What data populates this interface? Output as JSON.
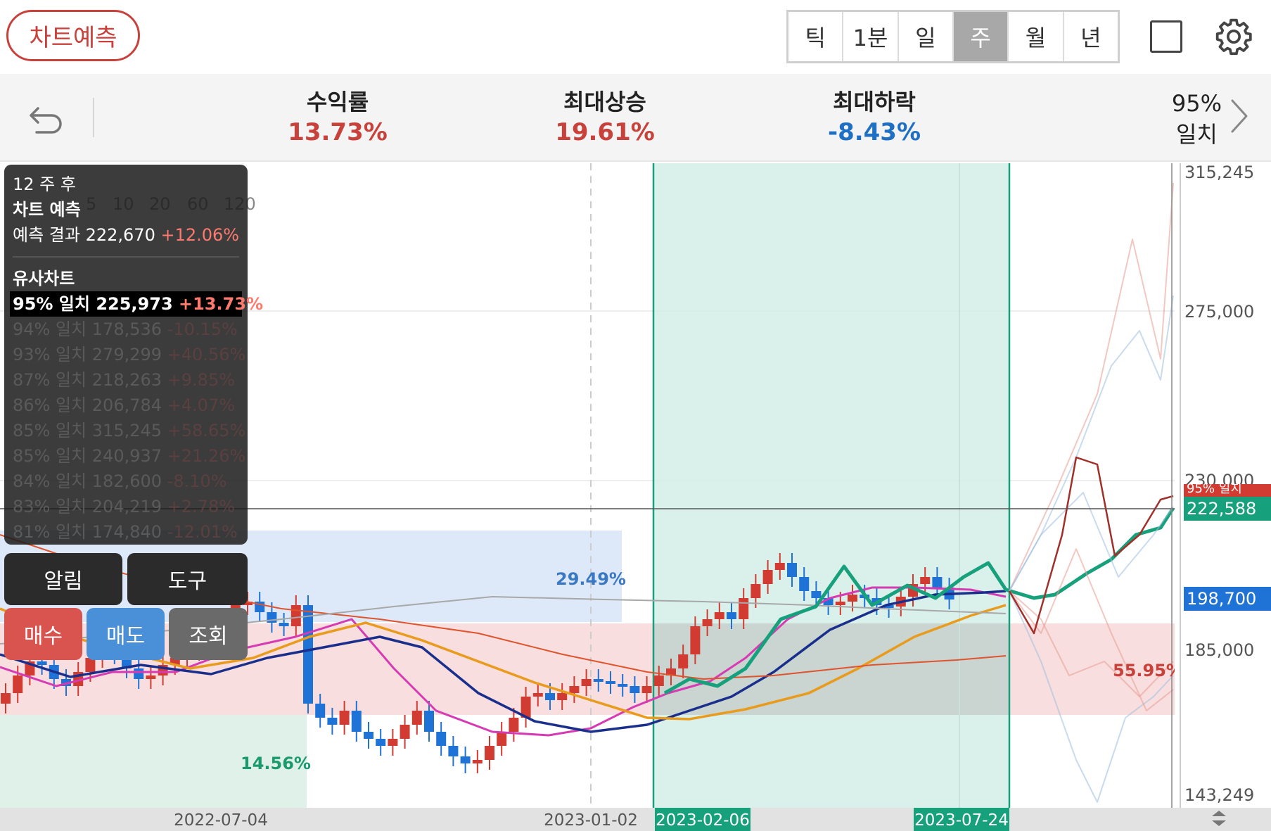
{
  "header": {
    "forecast_button": "차트예측",
    "periods": [
      "틱",
      "1분",
      "일",
      "주",
      "월",
      "년"
    ],
    "active_period": "주"
  },
  "stats": {
    "return_label": "수익률",
    "return_value": "13.73%",
    "max_rise_label": "최대상승",
    "max_rise_value": "19.61%",
    "max_drop_label": "최대하락",
    "max_drop_value": "-8.43%",
    "match_pct": "95%",
    "match_word": "일치"
  },
  "info_panel": {
    "weeks_after": "12 주 후",
    "forecast_title": "차트 예측",
    "forecast_result_label": "예측 결과",
    "forecast_result_price": "222,670",
    "forecast_result_change": "+12.06%",
    "similar_title": "유사차트",
    "matches": [
      {
        "label": "95% 일치",
        "price": "225,973",
        "change": "+13.73%",
        "dir": "pos"
      },
      {
        "label": "94% 일치",
        "price": "178,536",
        "change": "-10.15%",
        "dir": "neg"
      },
      {
        "label": "93% 일치",
        "price": "279,299",
        "change": "+40.56%",
        "dir": "pos"
      },
      {
        "label": "87% 일치",
        "price": "218,263",
        "change": "+9.85%",
        "dir": "pos"
      },
      {
        "label": "86% 일치",
        "price": "206,784",
        "change": "+4.07%",
        "dir": "pos"
      },
      {
        "label": "85% 일치",
        "price": "315,245",
        "change": "+58.65%",
        "dir": "pos"
      },
      {
        "label": "85% 일치",
        "price": "240,937",
        "change": "+21.26%",
        "dir": "pos"
      },
      {
        "label": "84% 일치",
        "price": "182,600",
        "change": "-8.10%",
        "dir": "neg"
      },
      {
        "label": "83% 일치",
        "price": "204,219",
        "change": "+2.78%",
        "dir": "pos"
      },
      {
        "label": "81% 일치",
        "price": "174,840",
        "change": "-12.01%",
        "dir": "neg"
      }
    ]
  },
  "buttons": {
    "alarm": "알림",
    "tools": "도구",
    "buy": "매수",
    "sell": "매도",
    "lookup": "조회"
  },
  "chart": {
    "y_ticks": [
      "315,245",
      "275,000",
      "230,000",
      "185,000",
      "143,249"
    ],
    "x_ticks": [
      "2022-07-04",
      "2023-01-02"
    ],
    "range_start": "2023-02-06",
    "range_end": "2023-07-24",
    "current_price": "222,588",
    "low_tag": "198,700",
    "match_tag": "95% 일치",
    "zone_upper_pct": "29.49%",
    "zone_lower_pct": "14.56%",
    "zone_red_pct": "55.95%",
    "legend_ma": [
      "5",
      "10",
      "20",
      "60",
      "120"
    ],
    "colors": {
      "up": "#d23b32",
      "down": "#1f73d6",
      "forecast": "#17a07c",
      "ma5": "#d63bb4",
      "ma10": "#1a2f8c",
      "ma20": "#e89b1c",
      "ma60": "#e0542d",
      "ma120": "#a8a8a8"
    }
  }
}
